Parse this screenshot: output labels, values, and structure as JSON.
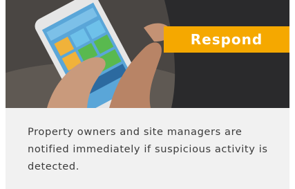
{
  "hero": {
    "badge_label": "Respond"
  },
  "caption": {
    "text": "Property owners and site managers are notified immediately if suspicious activity is detected."
  },
  "colors": {
    "badge_bg": "#f5a800",
    "card_bg": "#f1f1f1",
    "caption_text": "#3a3a3a"
  }
}
